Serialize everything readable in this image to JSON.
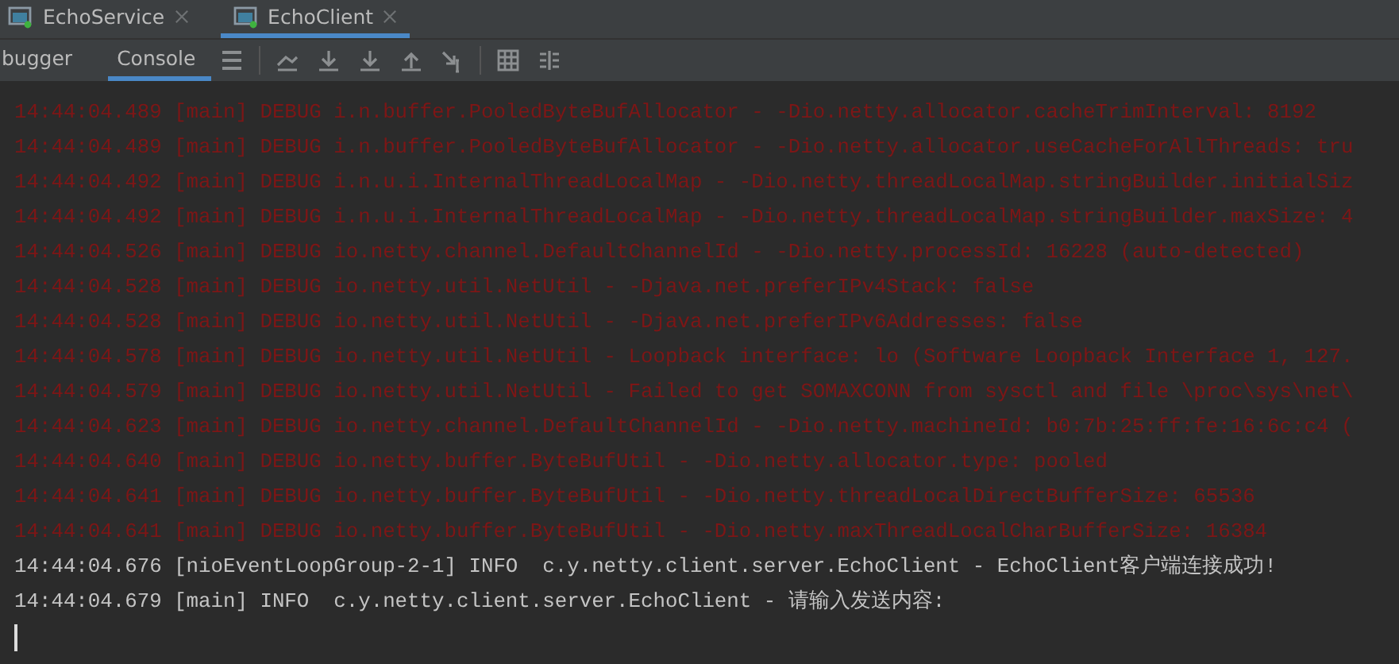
{
  "run_tabs": [
    {
      "label": "EchoService",
      "selected": false
    },
    {
      "label": "EchoClient",
      "selected": true
    }
  ],
  "tool_tabs": [
    {
      "label": "bugger",
      "selected": false
    },
    {
      "label": "Console",
      "selected": true
    }
  ],
  "console": {
    "lines": [
      {
        "kind": "debug",
        "text": "14:44:04.489 [main] DEBUG i.n.buffer.PooledByteBufAllocator - -Dio.netty.allocator.cacheTrimInterval: 8192"
      },
      {
        "kind": "debug",
        "text": "14:44:04.489 [main] DEBUG i.n.buffer.PooledByteBufAllocator - -Dio.netty.allocator.useCacheForAllThreads: tru"
      },
      {
        "kind": "debug",
        "text": "14:44:04.492 [main] DEBUG i.n.u.i.InternalThreadLocalMap - -Dio.netty.threadLocalMap.stringBuilder.initialSiz"
      },
      {
        "kind": "debug",
        "text": "14:44:04.492 [main] DEBUG i.n.u.i.InternalThreadLocalMap - -Dio.netty.threadLocalMap.stringBuilder.maxSize: 4"
      },
      {
        "kind": "debug",
        "text": "14:44:04.526 [main] DEBUG io.netty.channel.DefaultChannelId - -Dio.netty.processId: 16228 (auto-detected)"
      },
      {
        "kind": "debug",
        "text": "14:44:04.528 [main] DEBUG io.netty.util.NetUtil - -Djava.net.preferIPv4Stack: false"
      },
      {
        "kind": "debug",
        "text": "14:44:04.528 [main] DEBUG io.netty.util.NetUtil - -Djava.net.preferIPv6Addresses: false"
      },
      {
        "kind": "debug",
        "text": "14:44:04.578 [main] DEBUG io.netty.util.NetUtil - Loopback interface: lo (Software Loopback Interface 1, 127."
      },
      {
        "kind": "debug",
        "text": "14:44:04.579 [main] DEBUG io.netty.util.NetUtil - Failed to get SOMAXCONN from sysctl and file \\proc\\sys\\net\\"
      },
      {
        "kind": "debug",
        "text": "14:44:04.623 [main] DEBUG io.netty.channel.DefaultChannelId - -Dio.netty.machineId: b0:7b:25:ff:fe:16:6c:c4 ("
      },
      {
        "kind": "debug",
        "text": "14:44:04.640 [main] DEBUG io.netty.buffer.ByteBufUtil - -Dio.netty.allocator.type: pooled"
      },
      {
        "kind": "debug",
        "text": "14:44:04.641 [main] DEBUG io.netty.buffer.ByteBufUtil - -Dio.netty.threadLocalDirectBufferSize: 65536"
      },
      {
        "kind": "debug",
        "text": "14:44:04.641 [main] DEBUG io.netty.buffer.ByteBufUtil - -Dio.netty.maxThreadLocalCharBufferSize: 16384"
      },
      {
        "kind": "info",
        "text": "14:44:04.676 [nioEventLoopGroup-2-1] INFO  c.y.netty.client.server.EchoClient - EchoClient客户端连接成功!"
      },
      {
        "kind": "info",
        "text": "14:44:04.679 [main] INFO  c.y.netty.client.server.EchoClient - 请输入发送内容:"
      }
    ]
  }
}
